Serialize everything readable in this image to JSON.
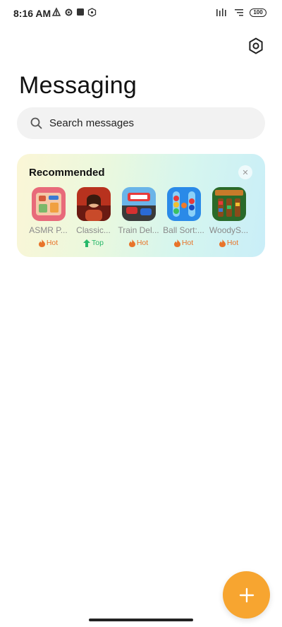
{
  "status_bar": {
    "time": "8:16 AM",
    "battery": "100"
  },
  "header": {
    "title": "Messaging"
  },
  "search": {
    "placeholder": "Search messages"
  },
  "recommended": {
    "title": "Recommended",
    "apps": [
      {
        "name": "ASMR P...",
        "badge": "Hot",
        "badge_type": "hot"
      },
      {
        "name": "Classic...",
        "badge": "Top",
        "badge_type": "top"
      },
      {
        "name": "Train Del...",
        "badge": "Hot",
        "badge_type": "hot"
      },
      {
        "name": "Ball Sort:...",
        "badge": "Hot",
        "badge_type": "hot"
      },
      {
        "name": "WoodyS...",
        "badge": "Hot",
        "badge_type": "hot"
      }
    ]
  },
  "colors": {
    "accent": "#f7a530",
    "hot": "#e8742a",
    "top": "#27b86a"
  }
}
